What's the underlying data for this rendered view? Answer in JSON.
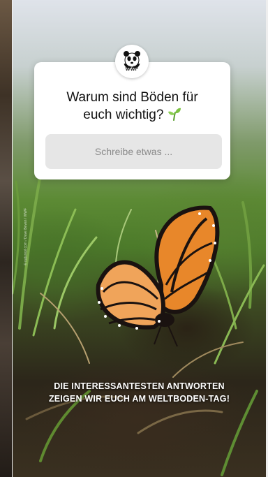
{
  "logo": {
    "icon": "panda-icon",
    "text": "WWF"
  },
  "question": {
    "line1": "Warum sind Böden für",
    "line2": "euch wichtig?",
    "emoji_icon": "seedling-icon"
  },
  "answer_input": {
    "placeholder": "Schreibe etwas ..."
  },
  "photo_credit": "© naturepl.com / Dave Bevan / WWF",
  "caption": {
    "line1": "DIE INTERESSANTESTEN ANTWORTEN",
    "line2": "ZEIGEN WIR EUCH AM WELTBODEN-TAG!"
  },
  "colors": {
    "card_background": "#ffffff",
    "input_background": "#e6e6e6",
    "caption_text": "#ffffff",
    "sprout_green": "#7cc242"
  }
}
